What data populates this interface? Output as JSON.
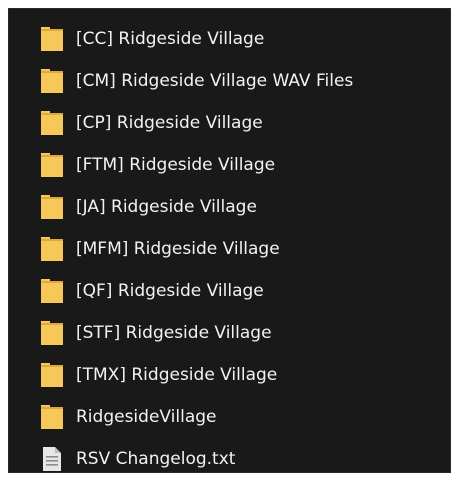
{
  "colors": {
    "background": "#191919",
    "text": "#f2f2f2",
    "folder": "#f6c85a",
    "folder_shadow": "#e0a93a",
    "file": "#e6e6e6"
  },
  "items": [
    {
      "label": "[CC] Ridgeside Village",
      "icon": "folder-icon"
    },
    {
      "label": "[CM] Ridgeside Village WAV Files",
      "icon": "folder-icon"
    },
    {
      "label": "[CP] Ridgeside Village",
      "icon": "folder-icon"
    },
    {
      "label": "[FTM] Ridgeside Village",
      "icon": "folder-icon"
    },
    {
      "label": "[JA] Ridgeside Village",
      "icon": "folder-icon"
    },
    {
      "label": "[MFM] Ridgeside Village",
      "icon": "folder-icon"
    },
    {
      "label": "[QF] Ridgeside Village",
      "icon": "folder-icon"
    },
    {
      "label": "[STF] Ridgeside Village",
      "icon": "folder-icon"
    },
    {
      "label": "[TMX] Ridgeside Village",
      "icon": "folder-icon"
    },
    {
      "label": "RidgesideVillage",
      "icon": "folder-icon"
    },
    {
      "label": "RSV Changelog.txt",
      "icon": "text-file-icon"
    }
  ]
}
